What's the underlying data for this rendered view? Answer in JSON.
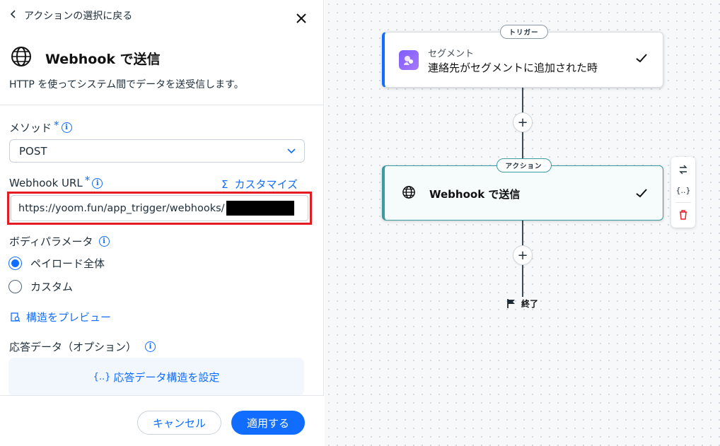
{
  "panel": {
    "back_label": "アクションの選択に戻る",
    "title": "Webhook で送信",
    "subtitle": "HTTP を使ってシステム間でデータを送受信します。",
    "method": {
      "label": "メソッド",
      "required_mark": "*",
      "value": "POST"
    },
    "url": {
      "label": "Webhook URL",
      "required_mark": "*",
      "customize_label": "カスタマイズ",
      "value": "https://yoom.fun/app_trigger/webhooks/"
    },
    "body": {
      "label": "ボディパラメータ",
      "options": [
        "ペイロード全体",
        "カスタム"
      ],
      "selected": 0
    },
    "preview_label": "構造をプレビュー",
    "response": {
      "label": "応答データ（オプション）",
      "button_label": "応答データ構造を設定",
      "button_prefix": "{..}"
    },
    "cancel_label": "キャンセル",
    "apply_label": "適用する"
  },
  "canvas": {
    "trigger": {
      "pill": "トリガー",
      "subtitle": "セグメント",
      "title": "連絡先がセグメントに追加された時"
    },
    "action": {
      "pill": "アクション",
      "title": "Webhook で送信"
    },
    "end_label": "終了",
    "toolbar_variable_label": "{..}"
  },
  "colors": {
    "accent": "#116dff",
    "highlight": "#e31b23",
    "action_teal": "#3a9ba0"
  }
}
